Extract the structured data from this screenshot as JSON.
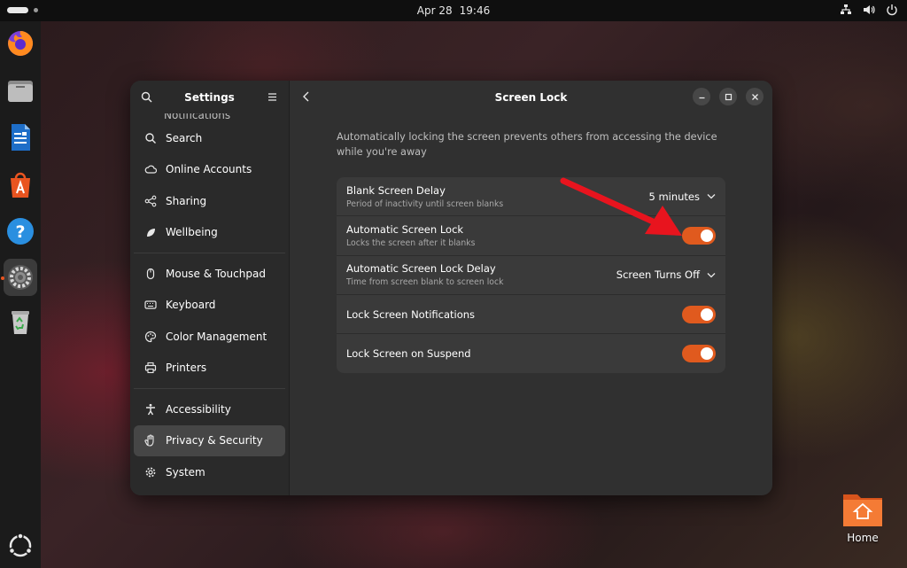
{
  "topbar": {
    "date": "Apr 28",
    "time": "19:46",
    "tray_icons": [
      "network-icon",
      "volume-icon",
      "power-icon"
    ]
  },
  "dock": {
    "items": [
      "firefox-icon",
      "files-icon",
      "writer-icon",
      "app-center-icon",
      "help-icon",
      "settings-icon",
      "trash-icon"
    ],
    "apps_grid_icon": "show-apps-icon"
  },
  "desktop": {
    "home_label": "Home"
  },
  "settings": {
    "sidebar_title": "Settings",
    "cut_item_label": "Notifications",
    "groups": [
      [
        {
          "label": "Search",
          "icon": "search-icon"
        },
        {
          "label": "Online Accounts",
          "icon": "cloud-icon"
        },
        {
          "label": "Sharing",
          "icon": "share-icon"
        },
        {
          "label": "Wellbeing",
          "icon": "leaf-icon"
        }
      ],
      [
        {
          "label": "Mouse & Touchpad",
          "icon": "mouse-icon"
        },
        {
          "label": "Keyboard",
          "icon": "keyboard-icon"
        },
        {
          "label": "Color Management",
          "icon": "palette-icon"
        },
        {
          "label": "Printers",
          "icon": "printer-icon"
        }
      ],
      [
        {
          "label": "Accessibility",
          "icon": "accessibility-icon"
        },
        {
          "label": "Privacy & Security",
          "icon": "hand-icon",
          "selected": true
        },
        {
          "label": "System",
          "icon": "gear-icon"
        }
      ]
    ],
    "page_title": "Screen Lock",
    "description": "Automatically locking the screen prevents others from accessing the device while you're away",
    "rows": [
      {
        "title": "Blank Screen Delay",
        "subtitle": "Period of inactivity until screen blanks",
        "control": "dropdown",
        "value": "5 minutes"
      },
      {
        "title": "Automatic Screen Lock",
        "subtitle": "Locks the screen after it blanks",
        "control": "toggle",
        "on": true
      },
      {
        "title": "Automatic Screen Lock Delay",
        "subtitle": "Time from screen blank to screen lock",
        "control": "dropdown",
        "value": "Screen Turns Off"
      },
      {
        "title": "Lock Screen Notifications",
        "subtitle": "",
        "control": "toggle",
        "on": true
      },
      {
        "title": "Lock Screen on Suspend",
        "subtitle": "",
        "control": "toggle",
        "on": true
      }
    ]
  },
  "colors": {
    "accent": "#e05a1e",
    "annotation_arrow": "#e8141e"
  }
}
